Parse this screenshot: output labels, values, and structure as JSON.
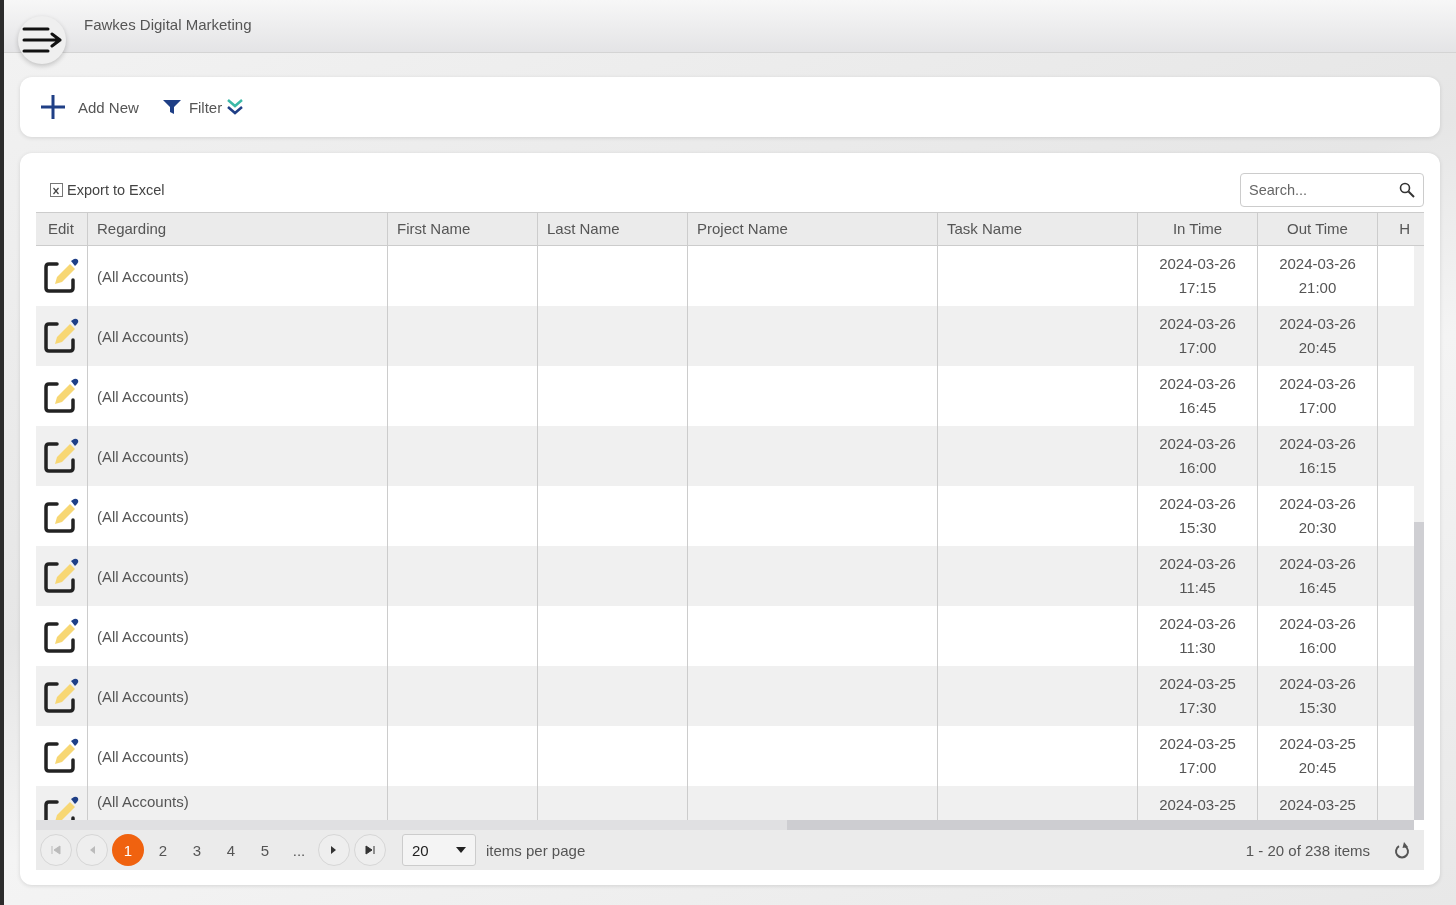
{
  "app_bar": {
    "title": "Fawkes Digital Marketing"
  },
  "toolbar": {
    "add_new": "Add New",
    "filter": "Filter"
  },
  "grid": {
    "export": "Export to Excel",
    "search": {
      "placeholder": "Search..."
    },
    "columns": [
      "Edit",
      "Regarding",
      "First Name",
      "Last Name",
      "Project Name",
      "Task Name",
      "In Time",
      "Out Time",
      "H"
    ],
    "rows": [
      {
        "regarding": "(All Accounts)",
        "in_time": "2024-03-26\n17:15",
        "out_time": "2024-03-26\n21:00"
      },
      {
        "regarding": "(All Accounts)",
        "in_time": "2024-03-26\n17:00",
        "out_time": "2024-03-26\n20:45"
      },
      {
        "regarding": "(All Accounts)",
        "in_time": "2024-03-26\n16:45",
        "out_time": "2024-03-26\n17:00"
      },
      {
        "regarding": "(All Accounts)",
        "in_time": "2024-03-26\n16:00",
        "out_time": "2024-03-26\n16:15"
      },
      {
        "regarding": "(All Accounts)",
        "in_time": "2024-03-26\n15:30",
        "out_time": "2024-03-26\n20:30"
      },
      {
        "regarding": "(All Accounts)",
        "in_time": "2024-03-26\n11:45",
        "out_time": "2024-03-26\n16:45"
      },
      {
        "regarding": "(All Accounts)",
        "in_time": "2024-03-26\n11:30",
        "out_time": "2024-03-26\n16:00"
      },
      {
        "regarding": "(All Accounts)",
        "in_time": "2024-03-25\n17:30",
        "out_time": "2024-03-26\n15:30"
      },
      {
        "regarding": "(All Accounts)",
        "in_time": "2024-03-25\n17:00",
        "out_time": "2024-03-25\n20:45"
      },
      {
        "regarding": "(All Accounts)",
        "in_time": "2024-03-25",
        "out_time": "2024-03-25"
      }
    ],
    "pager": {
      "pages": [
        {
          "label": "1",
          "selected": true
        },
        {
          "label": "2",
          "selected": false
        },
        {
          "label": "3",
          "selected": false
        },
        {
          "label": "4",
          "selected": false
        },
        {
          "label": "5",
          "selected": false
        }
      ],
      "more": "...",
      "page_size": "20",
      "page_size_label": "items per page",
      "summary": "1 - 20 of 238 items"
    }
  }
}
